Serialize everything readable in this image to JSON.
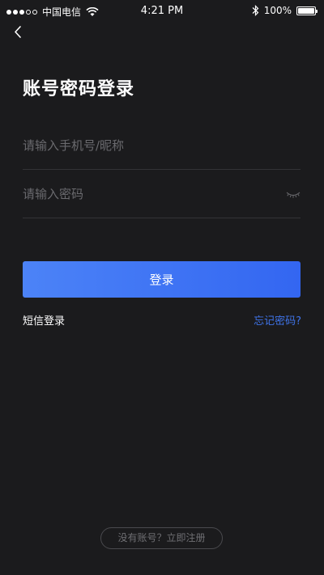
{
  "status_bar": {
    "carrier": "中国电信",
    "time": "4:21 PM",
    "battery": "100%",
    "battery_level": 1.0,
    "signal_icon": "signal-dots-icon",
    "wifi_icon": "wifi-icon",
    "bluetooth_icon": "bluetooth-icon",
    "battery_icon": "battery-icon"
  },
  "nav": {
    "back_icon": "chevron-left-icon"
  },
  "page": {
    "title": "账号密码登录"
  },
  "form": {
    "account_placeholder": "请输入手机号/昵称",
    "password_placeholder": "请输入密码",
    "password_toggle_icon": "eye-closed-icon",
    "login_label": "登录"
  },
  "links": {
    "sms_login": "短信登录",
    "forgot_password": "忘记密码?"
  },
  "footer": {
    "register": "没有账号？立即注册"
  },
  "colors": {
    "background": "#1b1b1d",
    "accent": "#3366f1",
    "link": "#3f73e8"
  }
}
